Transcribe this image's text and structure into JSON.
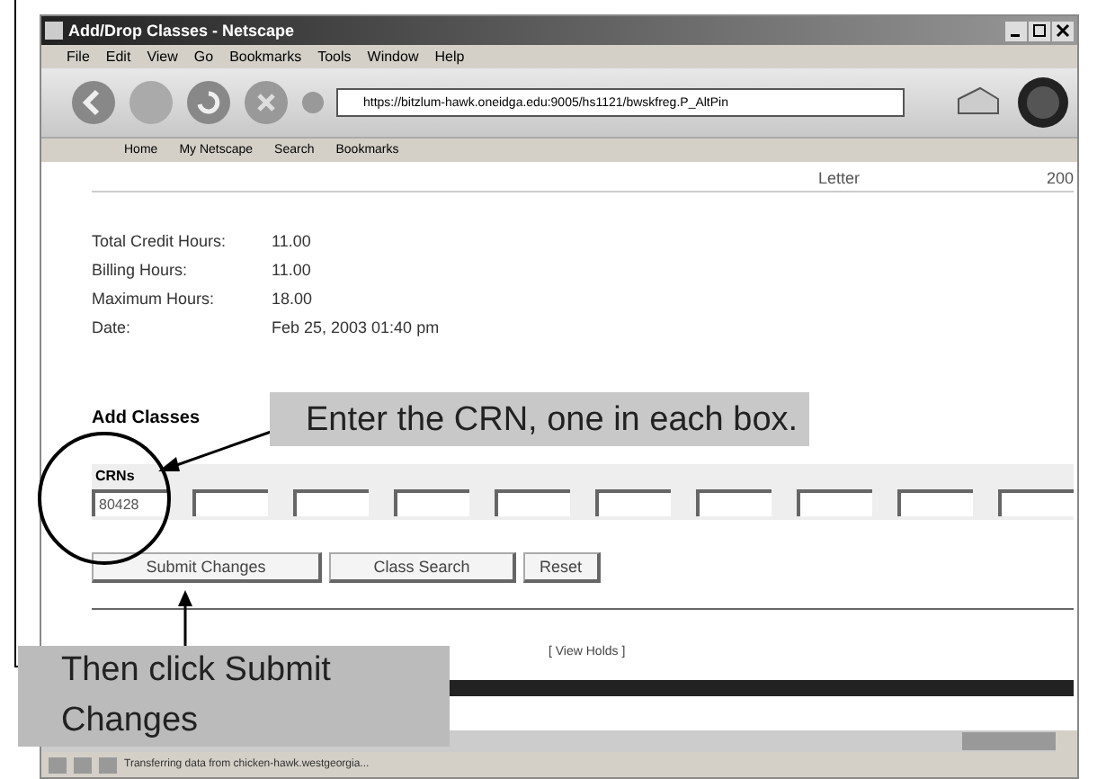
{
  "window": {
    "title": "Add/Drop Classes - Netscape"
  },
  "menu": [
    "File",
    "Edit",
    "View",
    "Go",
    "Bookmarks",
    "Tools",
    "Window",
    "Help"
  ],
  "address": {
    "value": "https://bitzlum-hawk.oneidga.edu:9005/hs1121/bwskfreg.P_AltPin"
  },
  "personal_toolbar": [
    "Home",
    "My Netscape",
    "Search",
    "Bookmarks"
  ],
  "top_row": [
    "Letter",
    "200"
  ],
  "info": [
    {
      "label": "Total Credit Hours:",
      "value": "11.00"
    },
    {
      "label": "Billing Hours:",
      "value": "11.00"
    },
    {
      "label": "Maximum Hours:",
      "value": "18.00"
    },
    {
      "label": "Date:",
      "value": "Feb 25, 2003 01:40 pm"
    }
  ],
  "add_classes": {
    "heading": "Add Classes",
    "column": "CRNs",
    "crns": [
      "80428"
    ]
  },
  "buttons": [
    "Submit Changes",
    "Class Search",
    "Reset"
  ],
  "links": [
    "[ View Holds ]"
  ],
  "status_bar": {
    "text": "Transferring data from chicken-hawk.westgeorgia..."
  },
  "callouts": [
    {
      "text": "Enter the CRN, one in each box."
    },
    {
      "text": "Then click Submit Changes"
    }
  ]
}
